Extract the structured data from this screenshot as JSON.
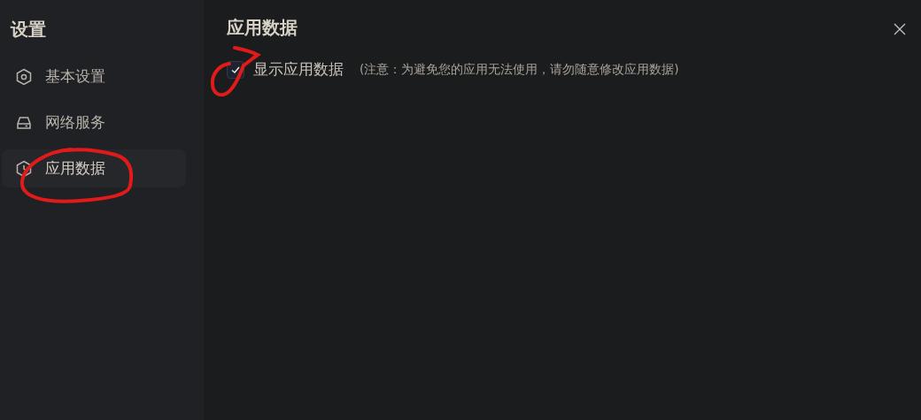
{
  "sidebar": {
    "title": "设置",
    "items": [
      {
        "label": "基本设置",
        "selected": false
      },
      {
        "label": "网络服务",
        "selected": false
      },
      {
        "label": "应用数据",
        "selected": true
      }
    ]
  },
  "main": {
    "title": "应用数据",
    "option": {
      "label": "显示应用数据",
      "checked": true,
      "note": "(注意：为避免您的应用无法使用，请勿随意修改应用数据)"
    }
  }
}
